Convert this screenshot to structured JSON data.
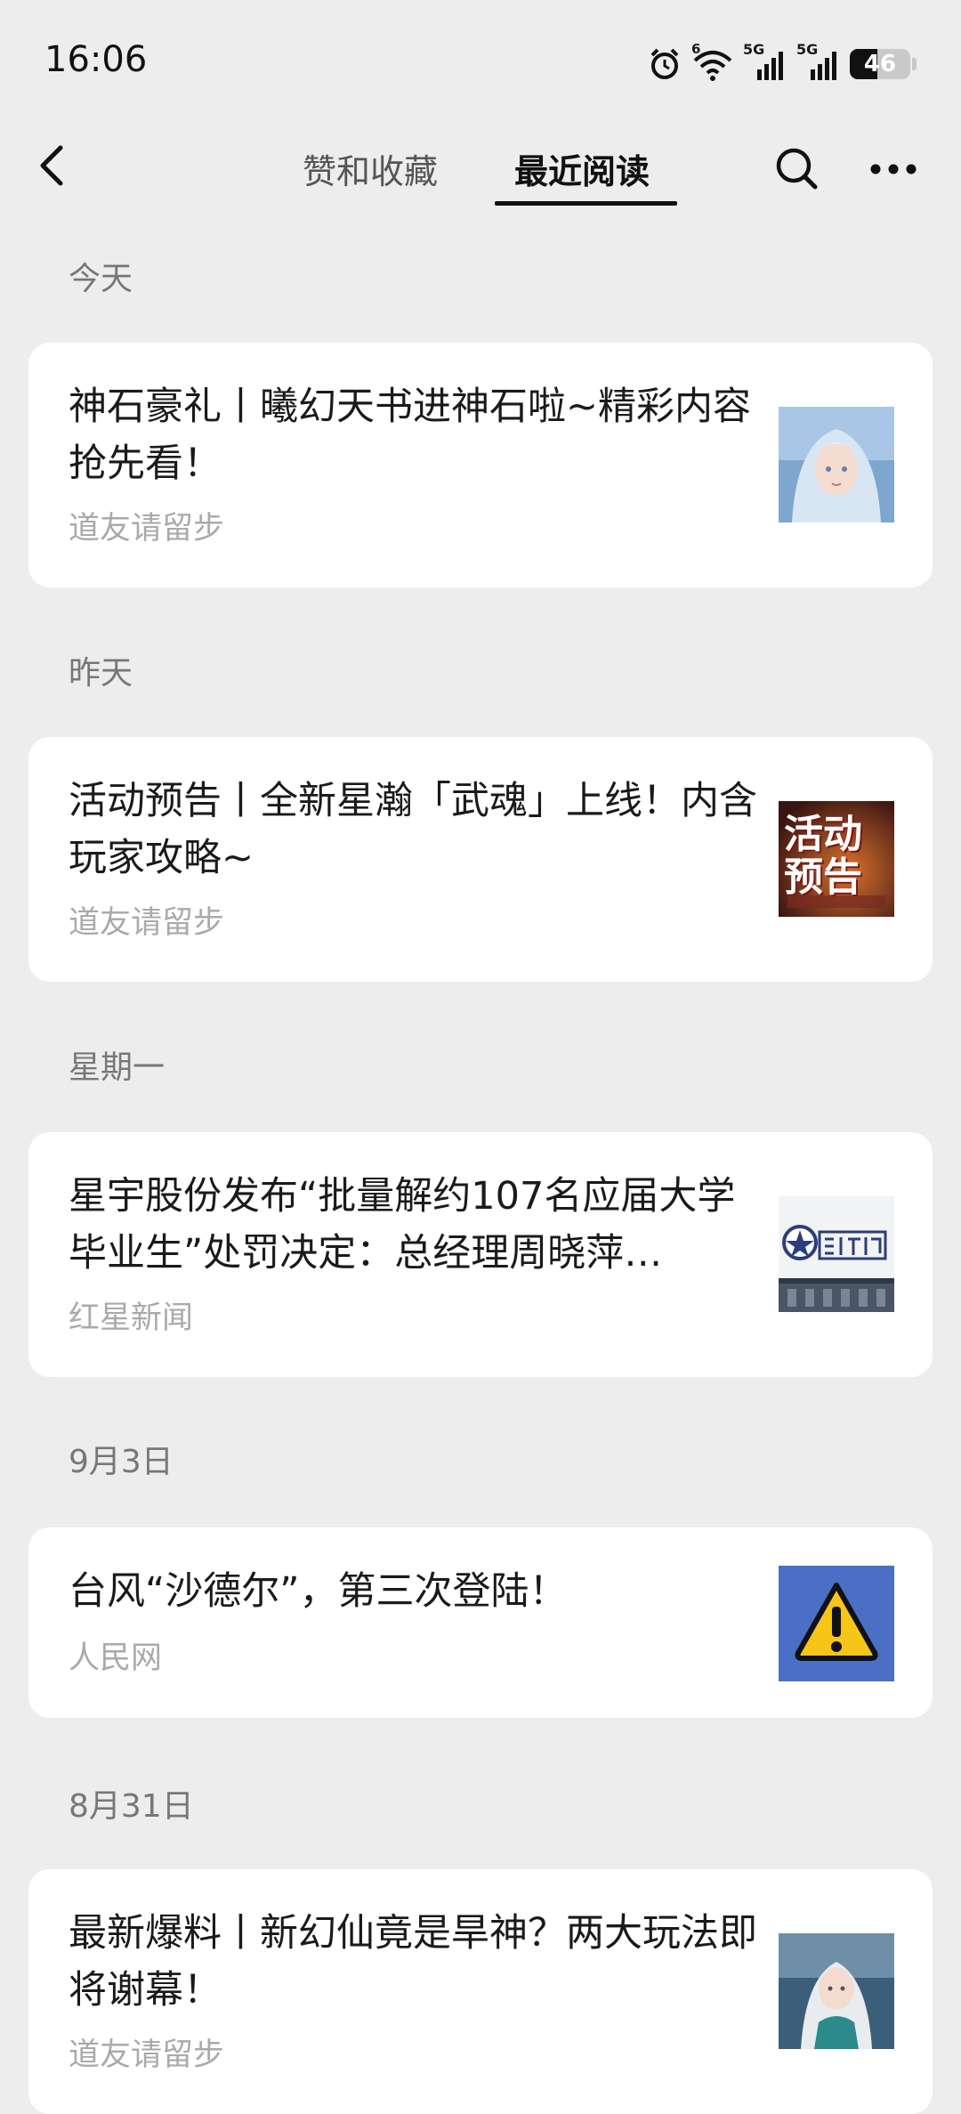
{
  "status_bar": {
    "time": "16:06",
    "signal_1_label": "5G",
    "signal_2_label": "5G",
    "wifi_label": "6",
    "battery": "46",
    "battery_level": 0.46,
    "icons": [
      "alarm-icon",
      "wifi-icon",
      "signal-icon",
      "signal-icon",
      "battery-icon"
    ]
  },
  "nav": {
    "tabs": [
      {
        "label": "赞和收藏",
        "active": false
      },
      {
        "label": "最近阅读",
        "active": true
      }
    ],
    "icons": [
      "back-icon",
      "search-icon",
      "more-icon"
    ]
  },
  "sections": [
    {
      "date": "今天",
      "items": [
        {
          "title": "神石豪礼丨曦幻天书进神石啦~精彩内容抢先看！",
          "source": "道友请留步",
          "thumb": "anime-character"
        }
      ]
    },
    {
      "date": "昨天",
      "items": [
        {
          "title": "活动预告丨全新星瀚「武魂」上线！内含玩家攻略~",
          "source": "道友请留步",
          "thumb": "event-poster",
          "thumb_text": "活动预告"
        }
      ]
    },
    {
      "date": "星期一",
      "items": [
        {
          "title": "星宇股份发布“批量解约107名应届大学毕业生”处罚决定：总经理周晓萍…",
          "source": "红星新闻",
          "thumb": "building-sign"
        }
      ]
    },
    {
      "date": "9月3日",
      "items": [
        {
          "title": "台风“沙德尔”，第三次登陆！",
          "source": "人民网",
          "thumb": "warning-sign"
        }
      ]
    },
    {
      "date": "8月31日",
      "items": [
        {
          "title": "最新爆料丨新幻仙竟是旱神？两大玩法即将谢幕！",
          "source": "道友请留步",
          "thumb": "anime-character"
        }
      ]
    }
  ],
  "colors": {
    "background": "#ededed",
    "card": "#ffffff",
    "warning_bg": "#4a6fc4",
    "warning_triangle": "#f5c518"
  }
}
